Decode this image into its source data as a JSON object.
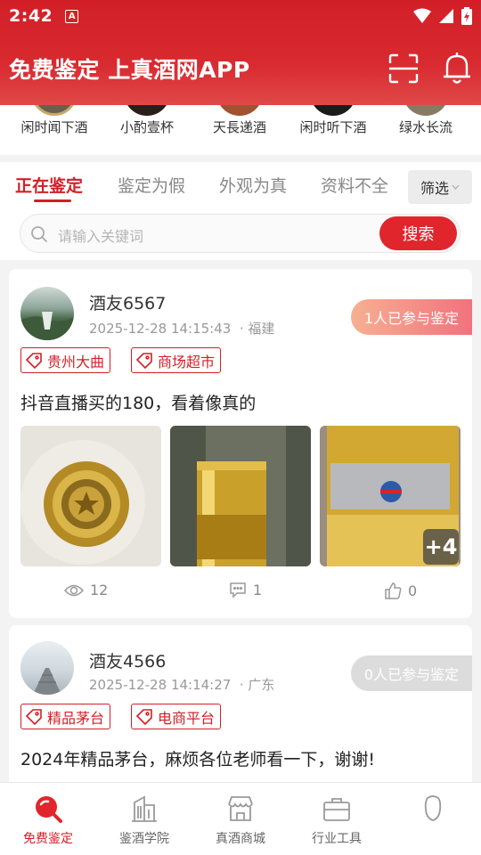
{
  "status_bar": {
    "time": "2:42",
    "a_icon": "A"
  },
  "header": {
    "title": "免费鉴定 上真酒网APP",
    "icons": [
      "scan-icon",
      "bell-icon"
    ]
  },
  "shops": [
    {
      "label": "闲时闻下酒"
    },
    {
      "label": "小酌壹杯"
    },
    {
      "label": "天長递酒"
    },
    {
      "label": "闲时听下酒"
    },
    {
      "label": "绿水长流"
    }
  ],
  "tabs": [
    {
      "label": "正在鉴定",
      "active": true
    },
    {
      "label": "鉴定为假"
    },
    {
      "label": "外观为真"
    },
    {
      "label": "资料不全"
    }
  ],
  "filter": {
    "label": "筛选"
  },
  "search": {
    "placeholder": "请输入关键词",
    "button": "搜索"
  },
  "posts": [
    {
      "username": "酒友6567",
      "datetime": "2025-12-28 14:15:43",
      "location": "· 福建",
      "participate": "1人已参与鉴定",
      "tags": [
        "贵州大曲",
        "商场超市"
      ],
      "text": "抖音直播买的180，看着像真的",
      "more": "+4",
      "views": "12",
      "comments": "1",
      "likes": "0"
    },
    {
      "username": "酒友4566",
      "datetime": "2025-12-28 14:14:27",
      "location": "· 广东",
      "participate": "0人已参与鉴定",
      "tags": [
        "精品茅台",
        "电商平台"
      ],
      "text": "2024年精品茅台，麻烦各位老师看一下，谢谢!"
    }
  ],
  "bottom_nav": [
    {
      "label": "免费鉴定",
      "active": true
    },
    {
      "label": "鉴酒学院"
    },
    {
      "label": "真酒商城"
    },
    {
      "label": "行业工具"
    },
    {
      "label": ""
    }
  ],
  "colors": {
    "brand_red": "#d21f27",
    "search_red": "#e1252d"
  }
}
